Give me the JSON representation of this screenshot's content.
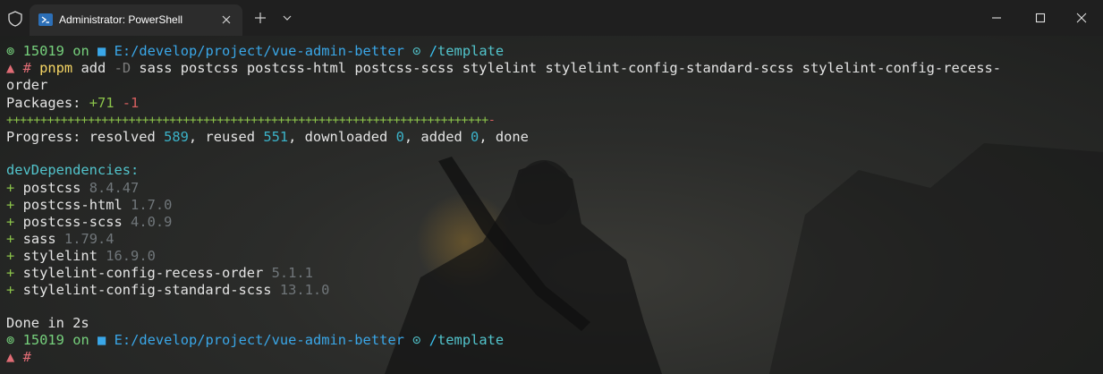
{
  "window": {
    "tab_title": "Administrator: PowerShell",
    "icons": [
      "shield-icon",
      "powershell-icon",
      "close-icon",
      "plus-icon",
      "chevron-down-icon",
      "minimize-icon",
      "maximize-icon",
      "window-close-icon"
    ]
  },
  "prompt1": {
    "symbol": "⊚",
    "pid": "15019",
    "on": "on",
    "folder_icon": "folder-icon",
    "path": "E:/develop/project/vue-admin-better",
    "git_icon": "git-branch-icon",
    "branch": "template"
  },
  "command": {
    "marker": "▲",
    "hash": "#",
    "cmd": "pnpm",
    "sub": "add",
    "flag": "-D",
    "args": "sass postcss postcss-html postcss-scss stylelint stylelint-config-standard-scss stylelint-config-recess-",
    "args_wrap": "order"
  },
  "output": {
    "packages_label": "Packages:",
    "packages_plus": "+71",
    "packages_minus": "-1",
    "progress_bar": "+++++++++++++++++++++++++++++++++++++++++++++++++++++++++++++++++++++++",
    "progress_bar_minus": "-",
    "progress_label": "Progress: resolved",
    "resolved": "589",
    "reused_label": ", reused",
    "reused": "551",
    "downloaded_label": ", downloaded",
    "downloaded": "0",
    "added_label": ", added",
    "added": "0",
    "done_label": ", done",
    "dev_header": "devDependencies:",
    "deps": [
      {
        "plus": "+",
        "name": "postcss",
        "version": "8.4.47"
      },
      {
        "plus": "+",
        "name": "postcss-html",
        "version": "1.7.0"
      },
      {
        "plus": "+",
        "name": "postcss-scss",
        "version": "4.0.9"
      },
      {
        "plus": "+",
        "name": "sass",
        "version": "1.79.4"
      },
      {
        "plus": "+",
        "name": "stylelint",
        "version": "16.9.0"
      },
      {
        "plus": "+",
        "name": "stylelint-config-recess-order",
        "version": "5.1.1"
      },
      {
        "plus": "+",
        "name": "stylelint-config-standard-scss",
        "version": "13.1.0"
      }
    ],
    "done": "Done in 2s"
  },
  "prompt2": {
    "symbol": "⊚",
    "pid": "15019",
    "on": "on",
    "path": "E:/develop/project/vue-admin-better",
    "branch": "template",
    "marker": "▲",
    "hash": "#"
  },
  "colors": {
    "titlebar": "#1f1f1f",
    "tab": "#2c2c2c",
    "prompt_green": "#76d07c",
    "path_blue": "#3aa7e8",
    "branch_cyan": "#52c4cc",
    "command_yellow": "#f5d564",
    "minus_red": "#d75f5f",
    "version_gray": "#70767a"
  }
}
